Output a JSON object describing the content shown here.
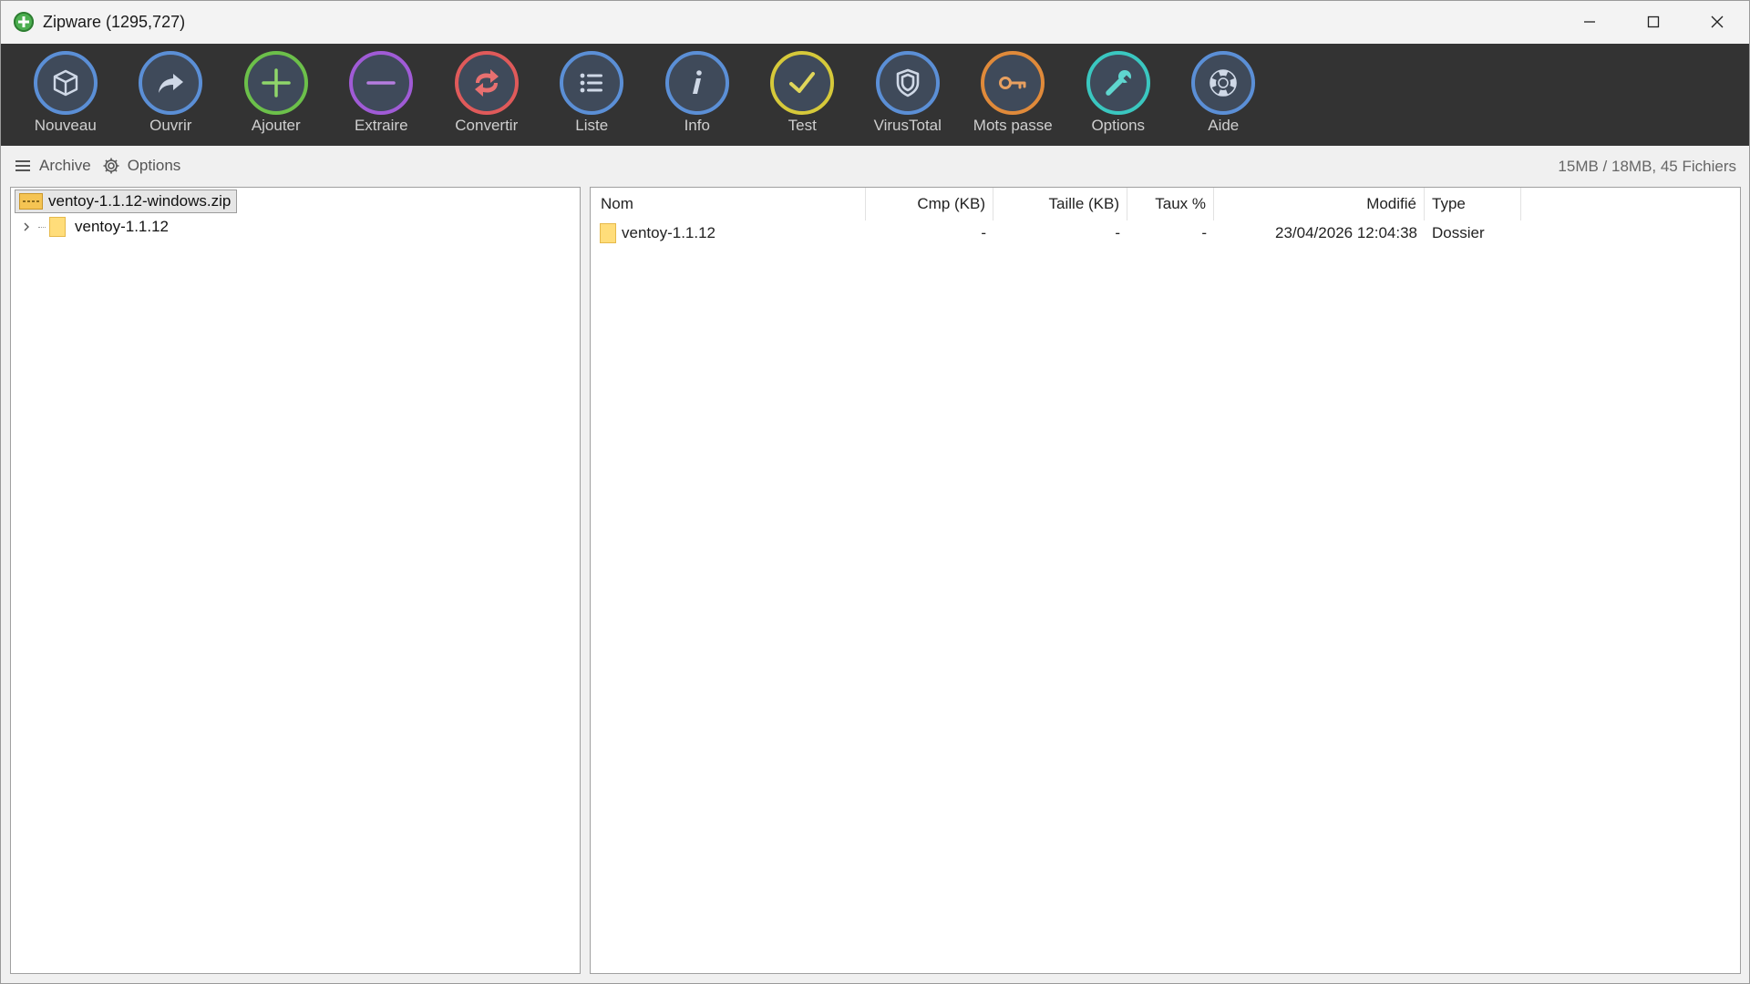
{
  "window": {
    "title": "Zipware (1295,727)",
    "controls": {
      "minimize": "minimize",
      "maximize": "maximize",
      "close": "close"
    }
  },
  "toolbar": {
    "items": [
      {
        "label": "Nouveau",
        "icon": "box-icon",
        "color": "#5b8fd6"
      },
      {
        "label": "Ouvrir",
        "icon": "share-arrow-icon",
        "color": "#5b8fd6"
      },
      {
        "label": "Ajouter",
        "icon": "plus-icon",
        "color": "#6cc04a"
      },
      {
        "label": "Extraire",
        "icon": "minus-icon",
        "color": "#a05bd6"
      },
      {
        "label": "Convertir",
        "icon": "convert-arrows-icon",
        "color": "#e05a5a"
      },
      {
        "label": "Liste",
        "icon": "list-icon",
        "color": "#5b8fd6"
      },
      {
        "label": "Info",
        "icon": "info-icon",
        "color": "#5b8fd6"
      },
      {
        "label": "Test",
        "icon": "check-icon",
        "color": "#d6c93a"
      },
      {
        "label": "VirusTotal",
        "icon": "shield-icon",
        "color": "#5b8fd6"
      },
      {
        "label": "Mots passe",
        "icon": "key-icon",
        "color": "#e08a3a"
      },
      {
        "label": "Options",
        "icon": "wrench-icon",
        "color": "#3ac7c0"
      },
      {
        "label": "Aide",
        "icon": "lifebuoy-icon",
        "color": "#5b8fd6"
      }
    ]
  },
  "menubar": {
    "archive_label": "Archive",
    "options_label": "Options",
    "status": "15MB / 18MB, 45 Fichiers"
  },
  "tree": {
    "root": "ventoy-1.1.12-windows.zip",
    "children": [
      {
        "label": "ventoy-1.1.12"
      }
    ]
  },
  "file_list": {
    "columns": {
      "name": "Nom",
      "compressed": "Cmp (KB)",
      "size": "Taille (KB)",
      "ratio": "Taux %",
      "modified": "Modifié",
      "type": "Type"
    },
    "rows": [
      {
        "name": "ventoy-1.1.12",
        "compressed": "-",
        "size": "-",
        "ratio": "-",
        "modified": "23/04/2026 12:04:38",
        "type": "Dossier"
      }
    ]
  }
}
